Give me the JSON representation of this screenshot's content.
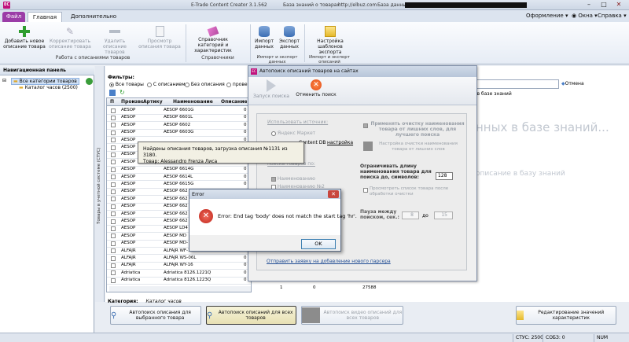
{
  "app": {
    "icon_text": "EC",
    "title": "E-Trade Content Creator 3.1.562",
    "kb_label": "База знаний о товарах",
    "url": "http://elbuz.com",
    "db_label": "База данных:"
  },
  "tabs": {
    "file": "Файл",
    "main": "Главная",
    "extra": "Дополнительно"
  },
  "right_menu": {
    "design": "Оформление",
    "windows": "Окна",
    "help": "Справка"
  },
  "ribbon": {
    "groups": [
      {
        "label": "Работа с описаниями товаров"
      },
      {
        "label": "Справочники"
      },
      {
        "label": "Импорт и экспорт данных"
      },
      {
        "label": "Импорт и экспорт описаний"
      }
    ],
    "buttons": {
      "add": "Добавить новое описание товара",
      "edit": "Корректировать описание товара",
      "delete": "Удалить описание товаров",
      "view": "Просмотр описания товара",
      "catalog": "Справочник категорий и характеристик",
      "import": "Импорт данных",
      "export": "Экспорт данных",
      "templates": "Настройка шаблонов экспорта"
    }
  },
  "nav": {
    "header": "Навигационная панель",
    "root": "Все категории товаров",
    "child": "Каталог часов (2500)",
    "vertical_tab": "Товары в учетной системе (СТУС)"
  },
  "filters": {
    "label": "Фильтры:",
    "all": "Все товары",
    "with_desc": "С описанием",
    "without_desc": "Без описания",
    "checked": "прове",
    "cancel": "Отмена",
    "kb_search": "е в базе знаний",
    "placeholder_big": "нных в базе знаний...",
    "placeholder_small": "описание в базу знаний"
  },
  "grid": {
    "columns": [
      "П",
      "Произво",
      "Артику",
      "Наименование",
      "Описание"
    ],
    "rows": [
      {
        "brand": "AESOP",
        "name": "AESOP 6601G"
      },
      {
        "brand": "AESOP",
        "name": "AESOP 6601L"
      },
      {
        "brand": "AESOP",
        "name": "AESOP 6602"
      },
      {
        "brand": "AESOP",
        "name": "AESOP 6603G"
      },
      {
        "brand": "AESOP",
        "name": ""
      },
      {
        "brand": "AESOP",
        "name": ""
      },
      {
        "brand": "AESOP",
        "name": ""
      },
      {
        "brand": "AESOP",
        "name": ""
      },
      {
        "brand": "AESOP",
        "name": "AESOP 6614G"
      },
      {
        "brand": "AESOP",
        "name": "AESOP 6614L"
      },
      {
        "brand": "AESOP",
        "name": "AESOP 6615G"
      },
      {
        "brand": "AESOP",
        "name": "AESOP 662"
      },
      {
        "brand": "AESOP",
        "name": "AESOP 662"
      },
      {
        "brand": "AESOP",
        "name": "AESOP 662"
      },
      {
        "brand": "AESOP",
        "name": "AESOP 662"
      },
      {
        "brand": "AESOP",
        "name": "AESOP 662"
      },
      {
        "brand": "AESOP",
        "name": "AESOP LD4"
      },
      {
        "brand": "AESOP",
        "name": "AESOP MD"
      },
      {
        "brand": "AESOP",
        "name": "AESOP MD-"
      },
      {
        "brand": "ALFAJR",
        "name": "ALFAJR WF-14L"
      },
      {
        "brand": "ALFAJR",
        "name": "ALFAJR WS-06L"
      },
      {
        "brand": "ALFAJR",
        "name": "ALFAJR WY-16"
      },
      {
        "brand": "Adriatica",
        "name": "Adriatica 8126.1221Q"
      },
      {
        "brand": "Adriatica",
        "name": "Adriatica 8126.1223Q"
      }
    ],
    "desc_values": [
      "0",
      "0",
      "0",
      "0",
      "0",
      "0",
      "0",
      "0",
      "0",
      "0",
      "0",
      "0",
      "0",
      "0",
      "0",
      "0",
      "0",
      "0",
      "0",
      "0",
      "0",
      "0",
      "0",
      "0"
    ],
    "footer": {
      "a": "1",
      "b": "0",
      "c": "27588"
    }
  },
  "category": {
    "label": "Категория:",
    "value": "Каталог часов"
  },
  "bottom_buttons": {
    "single": "Автопоиск описания для выбранного товара",
    "all": "Автопоиск описаний для всех товаров",
    "all_disabled": "Автопоиск видео описаний для всех товаров",
    "edit_values": "Редактирование значений характеристик"
  },
  "status": {
    "stus": "СТУС: 2500",
    "sobz": "СОБЗ: 0",
    "num": "NUM"
  },
  "autosearch": {
    "title": "Автопоиск описаний товаров на сайтах",
    "start": "Запуск поиска",
    "cancel": "Отменить поиск",
    "use_source": "Использовать источник:",
    "yandex": "Яндекс Маркет",
    "content_db": "Content DB",
    "settings": "настройка",
    "product_search": "поиска товаров по:",
    "by_name": "Наименованию",
    "by_name2": "Наименованию №2",
    "apply_clean": "Применять очистку наименования товара от лишних слов, для лучшего поиска",
    "clean_settings": "Настройка очистки наименования товара от лишних слов",
    "limit_len": "Ограничивать длину наименования товара для поиска до, символов:",
    "limit_value": "128",
    "view_list": "Просмотреть список товара после обработки очистки",
    "pause": "Пауза между поиском, сек.:",
    "pause_from": "8",
    "pause_to_label": "до",
    "pause_to": "15",
    "parser_link": "Отправить заявку на добавление нового парсера"
  },
  "progress": {
    "line1": "Найдены описания товаров, загрузка описания №1131 из 3180.",
    "line2": "Товар: Alessandro Frenza Лиса"
  },
  "error": {
    "title": "Error",
    "message": "Error: End tag 'body' does not match the start tag 'hr'.",
    "ok": "OK"
  },
  "colors": {
    "file_tab": "#9b3ca7",
    "error_red": "#c0271c",
    "add_green": "#2e9d2e"
  }
}
